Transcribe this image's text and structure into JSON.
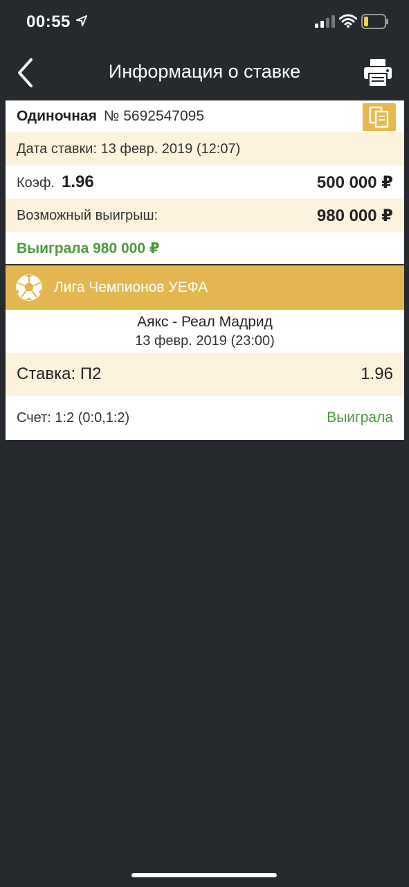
{
  "status_bar": {
    "time": "00:55"
  },
  "header": {
    "title": "Информация о ставке"
  },
  "bet": {
    "type": "Одиночная",
    "number": "№ 5692547095",
    "date": "Дата ставки: 13 февр. 2019 (12:07)",
    "coef_label": "Коэф.",
    "coef_value": "1.96",
    "stake": "500 000 ₽",
    "win_label": "Возможный выигрыш:",
    "win_value": "980 000 ₽",
    "result": "Выиграла 980 000 ₽"
  },
  "event": {
    "league": "Лига Чемпионов УЕФА",
    "teams": "Аякс - Реал Мадрид",
    "date": "13 февр. 2019 (23:00)",
    "pick_label": "Ставка: П2",
    "pick_odds": "1.96",
    "score": "Счет: 1:2 (0:0,1:2)",
    "outcome": "Выиграла"
  },
  "colors": {
    "background": "#262a2e",
    "accent": "#e3b64f",
    "cream": "#fdf3dc",
    "win_green": "#4c9a3a"
  },
  "icons": [
    "location-arrow-icon",
    "signal-icon",
    "wifi-icon",
    "battery-icon",
    "back-arrow-icon",
    "printer-icon",
    "document-icon",
    "soccer-ball-icon"
  ]
}
